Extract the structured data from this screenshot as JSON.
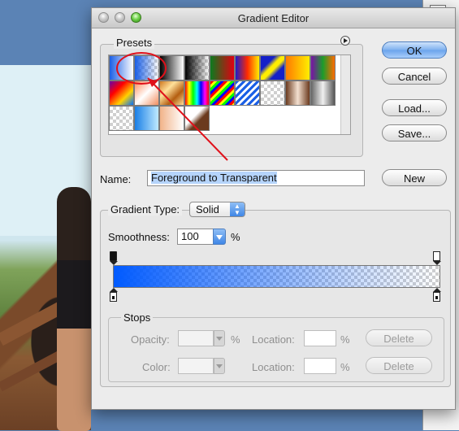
{
  "dialog": {
    "title": "Gradient Editor"
  },
  "presets": {
    "label": "Presets",
    "menu_icon": "triangle-right-circle-icon",
    "swatches": [
      "linear-gradient(90deg,#1a5fe6,#ffffff)",
      "linear-gradient(90deg,#1a5fe6 0%,rgba(26,95,230,0) 100%), repeating-conic-gradient(#cfcfcf 0 25%,#fff 0 50%) 0 0/8px 8px",
      "linear-gradient(90deg,#000,#fff)",
      "linear-gradient(90deg,#000,rgba(0,0,0,0)), repeating-conic-gradient(#cfcfcf 0 25%,#fff 0 50%) 0 0/8px 8px",
      "linear-gradient(90deg,#0b7a1e,#e00010)",
      "linear-gradient(90deg,#1c1cc8,#ff2a00,#ffee00)",
      "linear-gradient(135deg,#1420c8 0 30%,#ffee00 45%,#ffee00 55%,#1420c8 70%)",
      "linear-gradient(90deg,#ff7a00,#ffee00)",
      "linear-gradient(90deg,#7a0fa8,#1c9d2a,#ff6a00)",
      "linear-gradient(135deg,#6a00a8,#ff0000,#ffd200,#0070ff)",
      "linear-gradient(135deg,#ff8c5a,#ffffff,#f28e5e)",
      "linear-gradient(135deg,#d07a20,#ffe09a,#b45e10,#ffe09a)",
      "linear-gradient(90deg,#ff0000,#ffff00,#00ff00,#00ffff,#0000ff,#ff00ff,#ff0000)",
      "repeating-linear-gradient(135deg,#ff0000 0 3px,#ffff00 3px 6px,#00ff00 6px 9px,#0000ff 9px 12px)",
      "repeating-linear-gradient(135deg,#1a5fe6 0 3px,#ffffff 3px 6px)",
      "repeating-conic-gradient(#cfcfcf 0 25%,#fff 0 50%) 0 0/8px 8px",
      "linear-gradient(90deg,#6b3a1e,#f3e0d0,#6b3a1e)",
      "linear-gradient(90deg,#666,#f0f0f0,#555)",
      "repeating-conic-gradient(#cfcfcf 0 25%,#fff 0 50%) 0 0/8px 8px",
      "linear-gradient(90deg,#1a7fe6,#bfeaff)",
      "linear-gradient(90deg,#f1b389,#ffffff)",
      "linear-gradient(135deg,#ffffff 0 40%,#6b3a1e 60% 100%)"
    ]
  },
  "buttons": {
    "ok": "OK",
    "cancel": "Cancel",
    "load": "Load...",
    "save": "Save...",
    "new": "New"
  },
  "name": {
    "label": "Name:",
    "value": "Foreground to Transparent"
  },
  "gradient": {
    "type_label": "Gradient Type:",
    "type_value": "Solid",
    "smoothness_label": "Smoothness:",
    "smoothness_value": "100",
    "smoothness_unit": "%",
    "start_color": "#005aff"
  },
  "stops": {
    "label": "Stops",
    "opacity_label": "Opacity:",
    "opacity_unit": "%",
    "location_label_1": "Location:",
    "location_unit_1": "%",
    "delete_label_1": "Delete",
    "color_label": "Color:",
    "location_label_2": "Location:",
    "location_unit_2": "%",
    "delete_label_2": "Delete"
  },
  "annotation": {
    "color": "#e0101a"
  }
}
